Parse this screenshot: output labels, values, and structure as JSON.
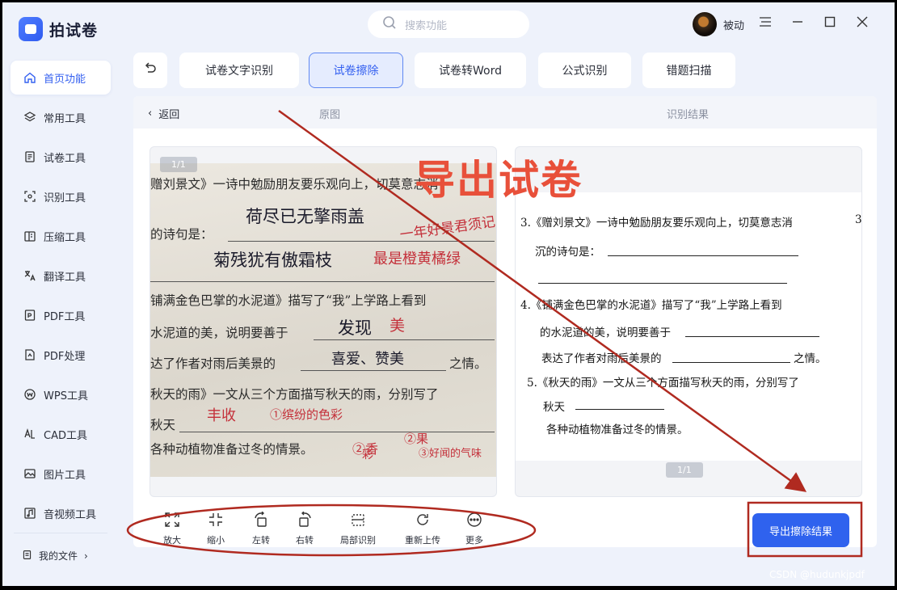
{
  "app": {
    "name": "拍试卷"
  },
  "sidebar": {
    "items": [
      {
        "label": "首页功能",
        "icon": "home-icon"
      },
      {
        "label": "常用工具",
        "icon": "layers-icon"
      },
      {
        "label": "试卷工具",
        "icon": "paper-icon"
      },
      {
        "label": "识别工具",
        "icon": "scan-icon"
      },
      {
        "label": "压缩工具",
        "icon": "compress-icon"
      },
      {
        "label": "翻译工具",
        "icon": "translate-icon"
      },
      {
        "label": "PDF工具",
        "icon": "pdf-icon"
      },
      {
        "label": "PDF处理",
        "icon": "pdf-process-icon"
      },
      {
        "label": "WPS工具",
        "icon": "wps-icon"
      },
      {
        "label": "CAD工具",
        "icon": "cad-icon"
      },
      {
        "label": "图片工具",
        "icon": "image-icon"
      },
      {
        "label": "音视频工具",
        "icon": "audio-video-icon"
      }
    ],
    "my_files": "我的文件"
  },
  "header": {
    "search_placeholder": "搜索功能",
    "username": "被动"
  },
  "tabs": [
    {
      "label": "试卷文字识别"
    },
    {
      "label": "试卷擦除"
    },
    {
      "label": "试卷转Word"
    },
    {
      "label": "公式识别"
    },
    {
      "label": "错题扫描"
    }
  ],
  "panel": {
    "back_label": "返回",
    "original_label": "原图",
    "result_label": "识别结果",
    "left_page": "1/1",
    "right_page": "1/1"
  },
  "original_image": {
    "lines": [
      "赠刘景文》一诗中勉励朋友要乐观向上，切莫意志消",
      "的诗句是：",
      "铺满金色巴掌的水泥道》描写了“我”上学路上看到",
      "水泥道的美，说明要善于",
      "达了作者对雨后美景的",
      "之情。",
      "秋天的雨》一文从三个方面描写秋天的雨，分别写了",
      "秋天",
      "各种动植物准备过冬的情景。"
    ],
    "handwriting": [
      "荷尽已无擎雨盖",
      "菊残犹有傲霜枝",
      "一年好景君须记",
      "最是橙黄橘绿",
      "发现",
      "美",
      "喜爱、赞美",
      "丰收",
      "①缤纷的色彩",
      "②香",
      "彩",
      "②果",
      "③好闻的气味"
    ]
  },
  "result_doc": {
    "lines": [
      "3.《赠刘景文》一诗中勉励朋友要乐观向上，切莫意志消",
      "沉的诗句是：",
      "4.《铺满金色巴掌的水泥道》描写了“我”上学路上看到",
      "的水泥道的美，说明要善于",
      "表达了作者对雨后美景的",
      "之情。",
      "5.《秋天的雨》一文从三个方面描写秋天的雨，分别写了",
      "秋天",
      "各种动植物准备过冬的情景。"
    ],
    "edge_number": "3"
  },
  "overlay": {
    "title": "导出试卷"
  },
  "toolbar": [
    {
      "label": "放大",
      "icon": "zoom-in-icon"
    },
    {
      "label": "缩小",
      "icon": "zoom-out-icon"
    },
    {
      "label": "左转",
      "icon": "rotate-left-icon"
    },
    {
      "label": "右转",
      "icon": "rotate-right-icon"
    },
    {
      "label": "局部识别",
      "icon": "partial-recognize-icon"
    },
    {
      "label": "重新上传",
      "icon": "reupload-icon"
    },
    {
      "label": "更多",
      "icon": "more-icon"
    }
  ],
  "export_button": "导出擦除结果",
  "watermark": "CSDN @hudunkjpdf",
  "colors": {
    "accent": "#2f62ee",
    "annotation": "#b02a20",
    "overlay_text": "#e8503a"
  }
}
